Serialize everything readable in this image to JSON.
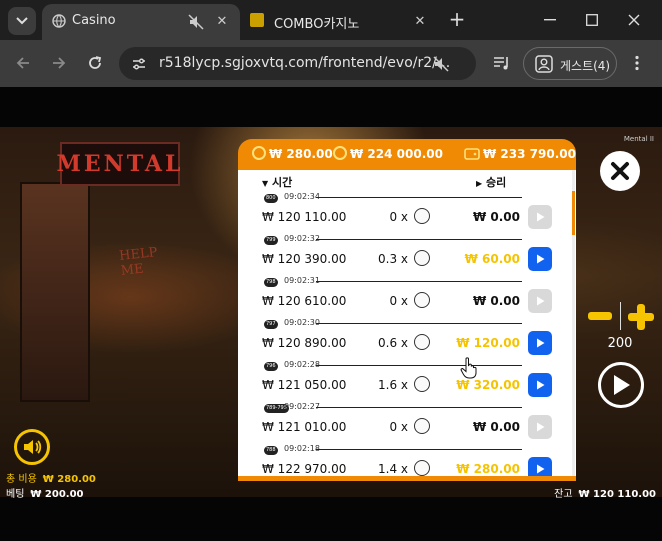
{
  "browser": {
    "tabs": [
      {
        "title": "Casino",
        "active": true
      },
      {
        "title": "COMBO카지노",
        "active": false
      }
    ],
    "url": "r518lycp.sgjoxvtq.com/frontend/evo/r2/...",
    "profile_label": "게스트(4)"
  },
  "game": {
    "brand_tag": "Mental II",
    "logo_text": "MENTAL",
    "wall_text": "HELP\nME",
    "header": {
      "stat1": "₩ 280.00",
      "stat2": "₩ 224 000.00",
      "stat3": "₩ 233 790.00"
    },
    "columns": {
      "time": "시간",
      "win": "승리"
    },
    "rows": [
      {
        "badge": "800",
        "time": "09:02:34",
        "amount": "₩ 120 110.00",
        "mult": "0 x",
        "win": "₩ 0.00",
        "win_gold": false,
        "play_active": false
      },
      {
        "badge": "799",
        "time": "09:02:32",
        "amount": "₩ 120 390.00",
        "mult": "0.3 x",
        "win": "₩ 60.00",
        "win_gold": true,
        "play_active": true
      },
      {
        "badge": "798",
        "time": "09:02:31",
        "amount": "₩ 120 610.00",
        "mult": "0 x",
        "win": "₩ 0.00",
        "win_gold": false,
        "play_active": false
      },
      {
        "badge": "797",
        "time": "09:02:30",
        "amount": "₩ 120 890.00",
        "mult": "0.6 x",
        "win": "₩ 120.00",
        "win_gold": true,
        "play_active": true
      },
      {
        "badge": "796",
        "time": "09:02:28",
        "amount": "₩ 121 050.00",
        "mult": "1.6 x",
        "win": "₩ 320.00",
        "win_gold": true,
        "play_active": true
      },
      {
        "badge": "789-795",
        "time": "09:02:27",
        "amount": "₩ 121 010.00",
        "mult": "0 x",
        "win": "₩ 0.00",
        "win_gold": false,
        "play_active": false
      },
      {
        "badge": "788",
        "time": "09:02:18",
        "amount": "₩ 122 970.00",
        "mult": "1.4 x",
        "win": "₩ 280.00",
        "win_gold": true,
        "play_active": true
      }
    ],
    "bet_value": "200",
    "total_cost_label": "총 비용",
    "total_cost_value": "₩ 280.00",
    "bet_label": "베팅",
    "bet_amount": "₩ 200.00",
    "balance_label": "잔고",
    "balance_value": "₩ 120 110.00"
  },
  "colors": {
    "accent": "#f08a05",
    "gold": "#f5c400",
    "play_blue": "#1262f0"
  }
}
